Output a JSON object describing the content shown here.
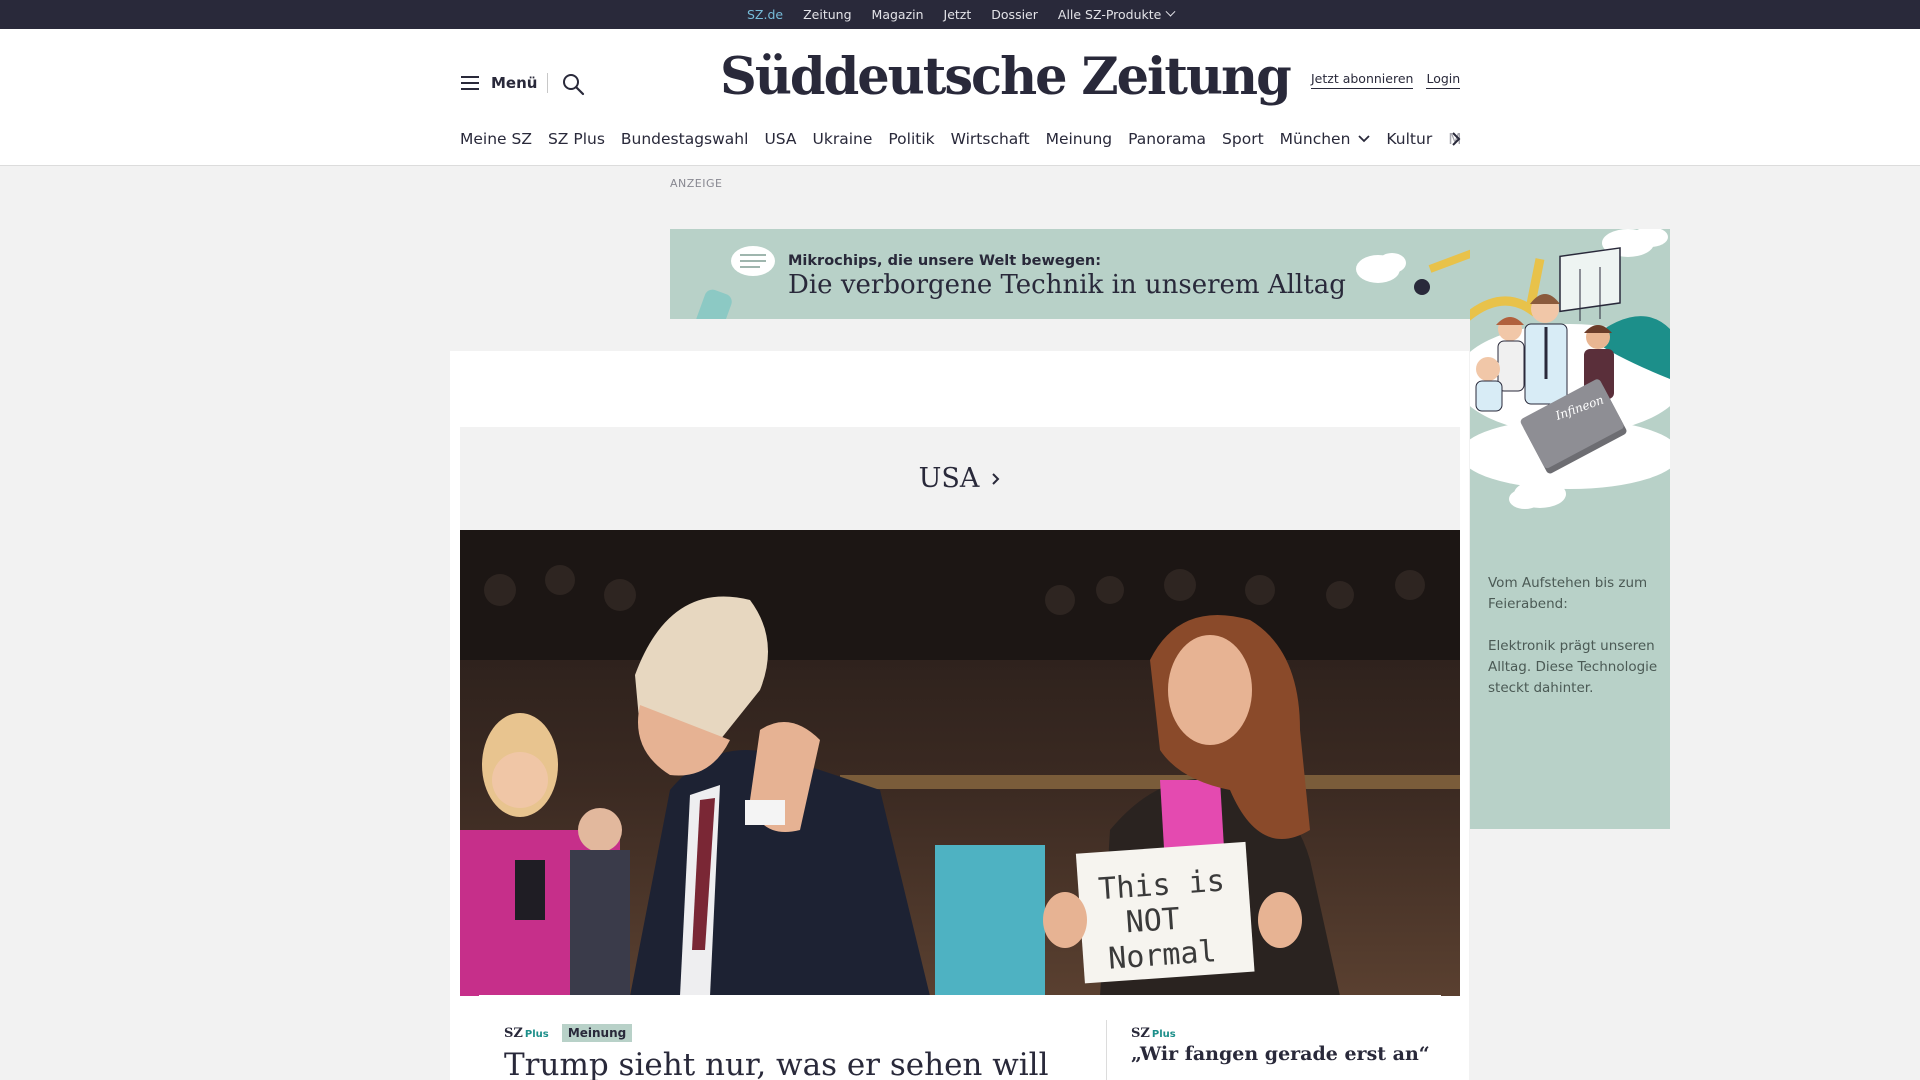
{
  "topbar": {
    "items": [
      "SZ.de",
      "Zeitung",
      "Magazin",
      "Jetzt",
      "Dossier"
    ],
    "products": "Alle SZ-Produkte"
  },
  "header": {
    "menu_label": "Menü",
    "logo": "Süddeutsche Zeitung",
    "subscribe": "Jetzt abonnieren",
    "login": "Login"
  },
  "nav": {
    "items": [
      "Meine SZ",
      "SZ Plus",
      "Bundestagswahl",
      "USA",
      "Ukraine",
      "Politik",
      "Wirtschaft",
      "Meinung",
      "Panorama",
      "Sport",
      "München",
      "Kultur",
      "M"
    ]
  },
  "ad": {
    "label": "ANZEIGE",
    "kicker": "Mikrochips, die unsere Welt bewegen:",
    "title": "Die verborgene Technik in unserem Alltag",
    "side_text_1": "Vom Aufstehen bis zum Feierabend:",
    "side_text_2": "Elektronik prägt unseren Alltag. Diese Technologie steckt dahinter.",
    "brand": "Infineon"
  },
  "section": {
    "title": "USA"
  },
  "hero": {
    "sign_line1": "This is",
    "sign_line2": "NOT",
    "sign_line3": "Normal"
  },
  "teaser_main": {
    "brand": "SZ",
    "plus": "Plus",
    "badge": "Meinung",
    "headline": "Trump sieht nur, was er sehen will"
  },
  "teaser_side": {
    "brand": "SZ",
    "plus": "Plus",
    "headline": "„Wir fangen gerade erst an“"
  },
  "colors": {
    "dark": "#29293a",
    "accent_teal": "#76bcd9",
    "ad_green": "#b8d1c8",
    "plus_green": "#1c8f8a"
  }
}
